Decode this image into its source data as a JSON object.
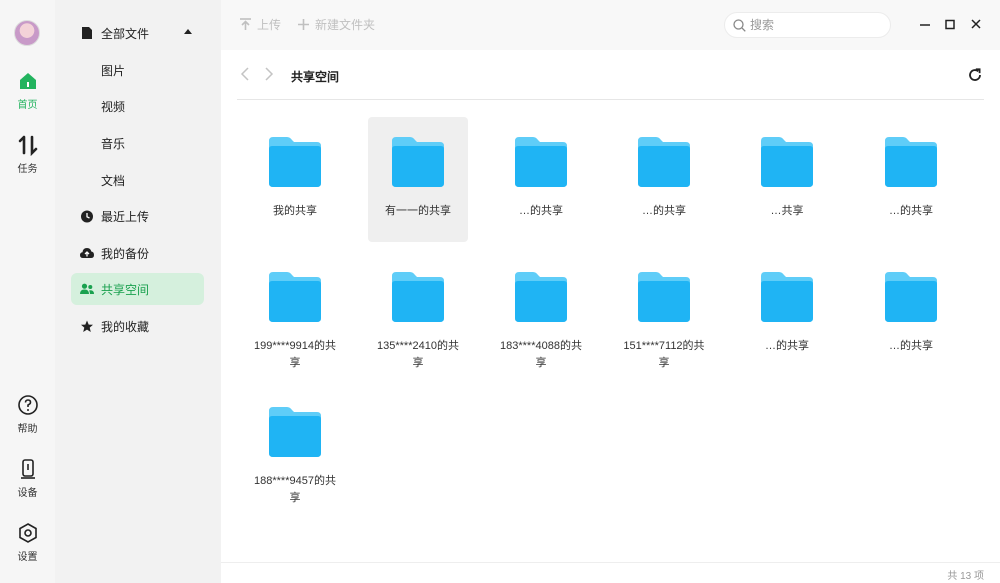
{
  "rail": {
    "items": [
      {
        "label": "首页"
      },
      {
        "label": "任务"
      },
      {
        "label": "帮助"
      },
      {
        "label": "设备"
      },
      {
        "label": "设置"
      }
    ]
  },
  "sidebar": {
    "items": [
      {
        "label": "全部文件"
      },
      {
        "label": "图片"
      },
      {
        "label": "视频"
      },
      {
        "label": "音乐"
      },
      {
        "label": "文档"
      },
      {
        "label": "最近上传"
      },
      {
        "label": "我的备份"
      },
      {
        "label": "共享空间"
      },
      {
        "label": "我的收藏"
      }
    ]
  },
  "toolbar": {
    "upload_label": "上传",
    "new_folder_label": "新建文件夹",
    "search_placeholder": "搜索"
  },
  "header": {
    "title": "共享空间"
  },
  "folders": [
    {
      "name": "我的共享"
    },
    {
      "name": "有一一的共享"
    },
    {
      "name": "…的共享"
    },
    {
      "name": "…的共享"
    },
    {
      "name": "…共享"
    },
    {
      "name": "…的共享"
    },
    {
      "name": "199****9914的共享"
    },
    {
      "name": "135****2410的共享"
    },
    {
      "name": "183****4088的共享"
    },
    {
      "name": "151****7112的共享"
    },
    {
      "name": "…的共享"
    },
    {
      "name": "…的共享"
    },
    {
      "name": "188****9457的共享"
    }
  ],
  "footer": {
    "count": "共 13 项"
  },
  "colors": {
    "accent": "#22b35e",
    "folder": "#29b6f6"
  }
}
